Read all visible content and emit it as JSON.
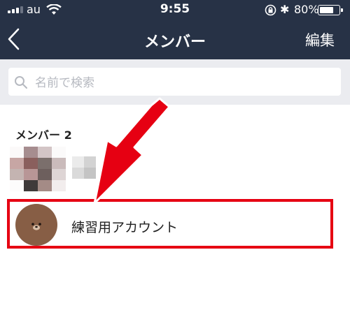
{
  "status_bar": {
    "carrier": "au",
    "time": "9:55",
    "battery_percent_text": "80%",
    "battery_level": 0.8,
    "icons": [
      "signal-icon",
      "wifi-icon",
      "rotation-lock-icon",
      "bluetooth-icon",
      "battery-icon"
    ]
  },
  "nav": {
    "title": "メンバー",
    "edit_label": "編集",
    "back_icon": "chevron-left-icon"
  },
  "search": {
    "placeholder": "名前で検索",
    "value": ""
  },
  "members": {
    "section_title": "メンバー 2",
    "items": [
      {
        "name": "",
        "avatar": "pixelated-avatar",
        "name_pixelated": true
      },
      {
        "name": "練習用アカウント",
        "avatar": "bear-avatar"
      }
    ]
  },
  "annotation": {
    "arrow_color": "#e60012",
    "highlight_color": "#e60012"
  },
  "colors": {
    "nav_background": "#273246",
    "search_band": "#ebecf0",
    "avatar_brown": "#875e45"
  }
}
